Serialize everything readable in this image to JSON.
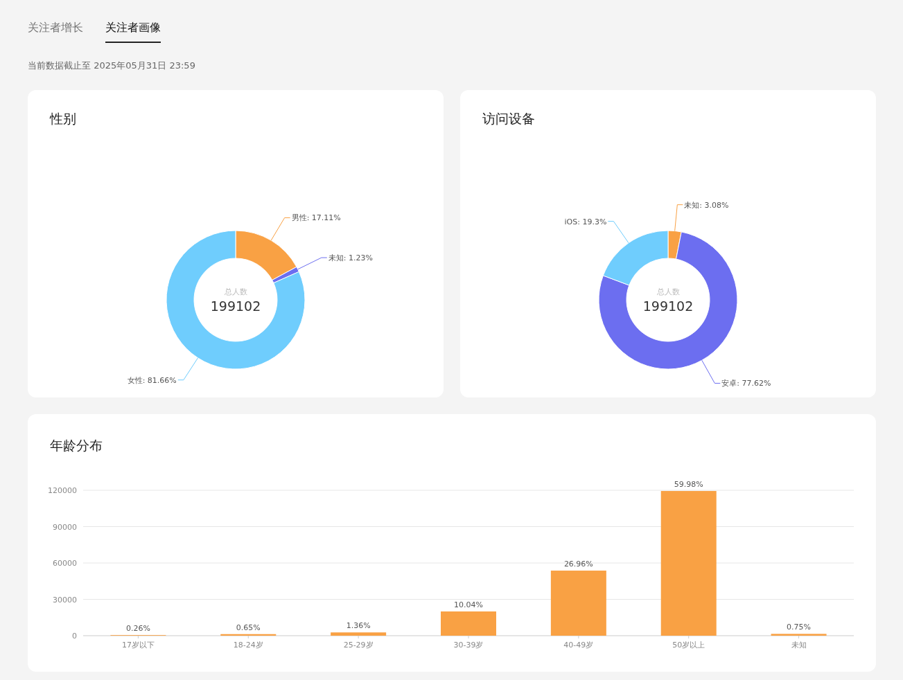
{
  "tabs": [
    {
      "label": "关注者增长",
      "selected": false
    },
    {
      "label": "关注者画像",
      "selected": true
    }
  ],
  "data_note": "当前数据截止至 2025年05月31日 23:59",
  "cards": [
    {
      "title": "性别",
      "center_label": "总人数",
      "center_value": "199102",
      "chart_data": {
        "type": "donut",
        "series": [
          {
            "values": [
              17.11,
              1.23,
              81.66
            ]
          }
        ],
        "colors": [
          "#f9a144",
          "#6c6ef0",
          "#6fcdfd"
        ],
        "value_labels": [
          "男性: 17.11%",
          "未知: 1.23%",
          "女性: 81.66%"
        ]
      }
    },
    {
      "title": "访问设备",
      "center_label": "总人数",
      "center_value": "199102",
      "chart_data": {
        "type": "donut",
        "series": [
          {
            "values": [
              3.08,
              77.62,
              19.3
            ]
          }
        ],
        "colors": [
          "#f9a144",
          "#6c6ef0",
          "#6fcdfd"
        ],
        "value_labels": [
          "未知: 3.08%",
          "安卓: 77.62%",
          "iOS: 19.3%"
        ]
      }
    }
  ],
  "age_card": {
    "title": "年龄分布",
    "chart_data": {
      "type": "bar",
      "grid": true,
      "categories": [
        "17岁以下",
        "18-24岁",
        "25-29岁",
        "30-39岁",
        "40-49岁",
        "50岁以上",
        "未知"
      ],
      "series": [
        {
          "color": "#f9a144",
          "values": [
            500,
            1300,
            2700,
            20000,
            53700,
            119400,
            1500
          ]
        }
      ],
      "ylim": [
        0,
        120000
      ],
      "yticks": [
        0,
        30000,
        60000,
        90000,
        120000
      ],
      "value_labels": [
        "0.26%",
        "0.65%",
        "1.36%",
        "10.04%",
        "26.96%",
        "59.98%",
        "0.75%"
      ]
    }
  }
}
